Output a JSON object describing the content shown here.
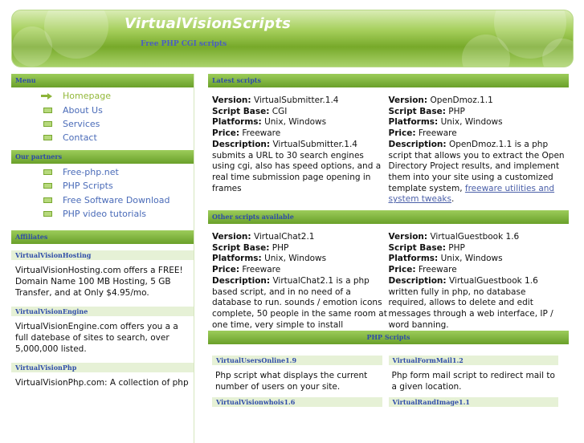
{
  "header": {
    "title": "VirtualVisionScripts",
    "subtitle": "Free PHP CGI scripts"
  },
  "sidebar": {
    "menu_title": "Menu",
    "menu": [
      {
        "label": "Homepage",
        "icon": "arrow-icon",
        "active": true
      },
      {
        "label": "About Us",
        "icon": "bullet-icon"
      },
      {
        "label": "Services",
        "icon": "bullet-icon"
      },
      {
        "label": "Contact",
        "icon": "bullet-icon"
      }
    ],
    "partners_title": "Our partners",
    "partners": [
      {
        "label": "Free-php.net"
      },
      {
        "label": "PHP Scripts"
      },
      {
        "label": "Free Software Download"
      },
      {
        "label": "PHP video tutorials"
      }
    ],
    "affiliates_title": "Affiliates",
    "affiliates": [
      {
        "name": "VirtualVisionHosting",
        "text": "VirtualVisionHosting.com offers a FREE! Domain Name 100 MB Hosting, 5 GB Transfer, and at Only $4.95/mo."
      },
      {
        "name": "VirtualVisionEngine",
        "text": "VirtualVisionEngine.com offers you a a full datebase of sites to search, over 5,000,000 listed."
      },
      {
        "name": "VirtualVisionPhp",
        "text": "VirtualVisionPhp.com: A collection of php"
      }
    ]
  },
  "latest": {
    "title": "Latest scripts",
    "labels": {
      "version": "Version:",
      "base": "Script Base:",
      "platforms": "Platforms:",
      "price": "Price:",
      "description": "Description:"
    },
    "items": [
      {
        "version": "VirtualSubmitter.1.4",
        "base": "CGI",
        "platforms": "Unix, Windows",
        "price": "Freeware",
        "description": "VirtualSubmitter.1.4 submits a URL to 30 search engines using cgi, also has speed options, and a real time submission page opening in frames"
      },
      {
        "version": "OpenDmoz.1.1",
        "base": "PHP",
        "platforms": "Unix, Windows",
        "price": "Freeware",
        "description": "OpenDmoz.1.1 is a php script that allows you to extract the Open Directory Project results, and implement them into your site using a customized template system,",
        "link1": "freeware utilities and system tweaks",
        "tail": "."
      }
    ]
  },
  "other": {
    "title": "Other scripts available",
    "items": [
      {
        "version": "VirtualChat2.1",
        "base": "PHP",
        "platforms": "Unix, Windows",
        "price": "Freeware",
        "description": "VirtualChat2.1 is a php based script, and in no need of a database to run. sounds / emotion icons complete, 50 people in the same room at one time, very simple to install"
      },
      {
        "version": "VirtualGuestbook 1.6",
        "base": "PHP",
        "platforms": "Unix, Windows",
        "price": "Freeware",
        "description": "VirtualGuestbook 1.6 written fully in php, no database required, allows to delete and edit messages through a web interface, IP / word banning."
      }
    ]
  },
  "php": {
    "title": "PHP Scripts",
    "items": [
      {
        "name": "VirtualUsersOnline1.9",
        "text": "Php script what displays the current number of users on your site."
      },
      {
        "name": "VirtualFormMail1.2",
        "text": "Php form mail script to redirect mail to a given location."
      },
      {
        "name": "VirtualVisionwhois1.6",
        "text": ""
      },
      {
        "name": "VirtualRandImage1.1",
        "text": ""
      }
    ]
  }
}
